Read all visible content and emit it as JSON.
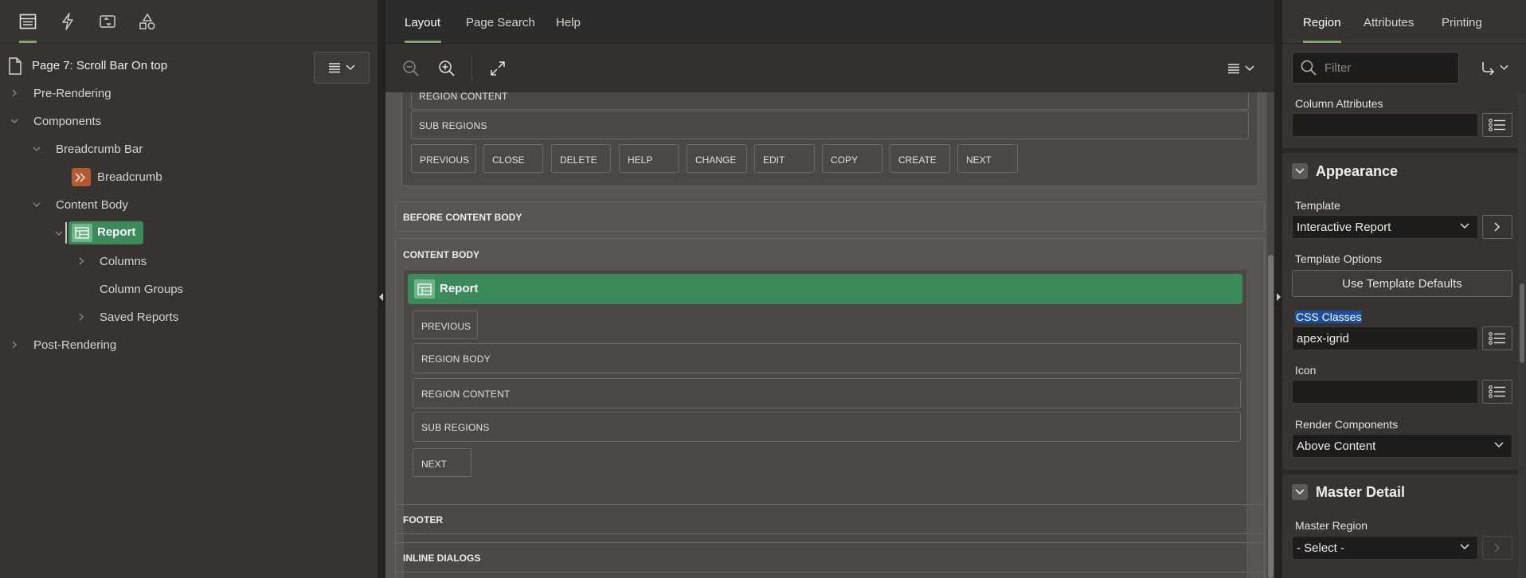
{
  "left_panel": {
    "tabs": [
      {
        "name": "rendering-tab-icon",
        "active": true
      },
      {
        "name": "dynamic-actions-tab-icon",
        "active": false
      },
      {
        "name": "processing-tab-icon",
        "active": false
      },
      {
        "name": "shared-components-tab-icon",
        "active": false
      }
    ],
    "page_title": "Page 7: Scroll Bar On top",
    "tree": {
      "pre_rendering": "Pre-Rendering",
      "components": "Components",
      "breadcrumb_bar": "Breadcrumb Bar",
      "breadcrumb": "Breadcrumb",
      "content_body": "Content Body",
      "report": "Report",
      "columns": "Columns",
      "column_groups": "Column Groups",
      "saved_reports": "Saved Reports",
      "post_rendering": "Post-Rendering"
    }
  },
  "center": {
    "tabs": [
      "Layout",
      "Page Search",
      "Help"
    ],
    "active_tab": "Layout",
    "top_region": {
      "region_content": "REGION CONTENT",
      "sub_regions": "SUB REGIONS",
      "buttons": [
        "PREVIOUS",
        "CLOSE",
        "DELETE",
        "HELP",
        "CHANGE",
        "EDIT",
        "COPY",
        "CREATE",
        "NEXT"
      ]
    },
    "before_content_body": "BEFORE CONTENT BODY",
    "content_body": "CONTENT BODY",
    "report_region": {
      "title": "Report",
      "previous": "PREVIOUS",
      "region_body": "REGION BODY",
      "region_content": "REGION CONTENT",
      "sub_regions": "SUB REGIONS",
      "next": "NEXT"
    },
    "footer": "FOOTER",
    "inline_dialogs": "INLINE DIALOGS"
  },
  "right_panel": {
    "tabs": [
      "Region",
      "Attributes",
      "Printing"
    ],
    "active_tab": "Region",
    "filter_placeholder": "Filter",
    "column_attributes_label": "Column Attributes",
    "column_attributes_value": "",
    "appearance": {
      "title": "Appearance",
      "template_label": "Template",
      "template_value": "Interactive Report",
      "template_options_label": "Template Options",
      "use_template_defaults": "Use Template Defaults",
      "css_classes_label": "CSS Classes",
      "css_classes_value": "apex-igrid",
      "icon_label": "Icon",
      "icon_value": "",
      "render_components_label": "Render Components",
      "render_components_value": "Above Content"
    },
    "master_detail": {
      "title": "Master Detail",
      "master_region_label": "Master Region",
      "master_region_value": "- Select -"
    }
  },
  "colors": {
    "accent_green": "#7fa56a",
    "report_green": "#3a8a5a",
    "selection_blue": "#1a4fa0",
    "breadcrumb_orange": "#b35a2e"
  }
}
